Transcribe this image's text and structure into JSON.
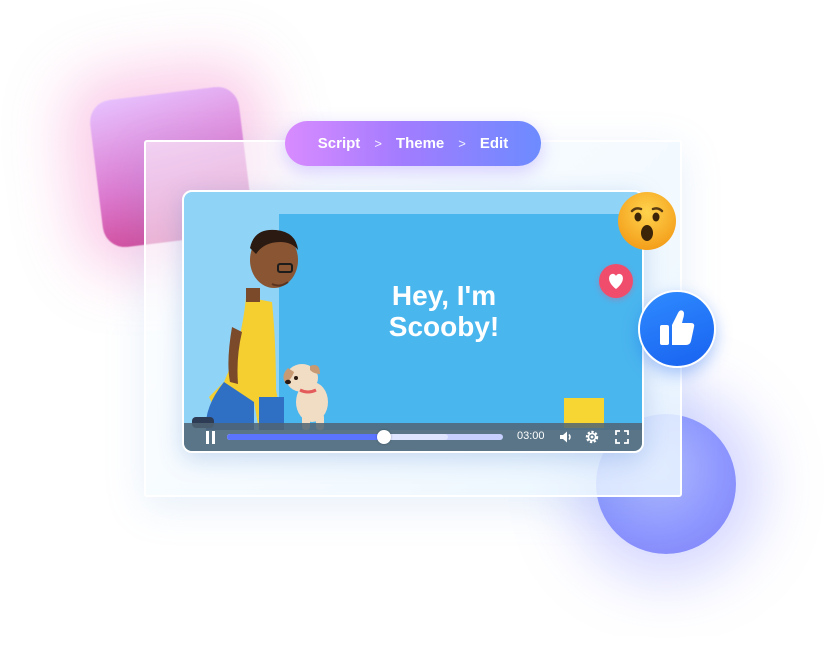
{
  "breadcrumb": {
    "steps": [
      "Script",
      "Theme",
      "Edit"
    ]
  },
  "video": {
    "title": "Hey, I'm\nScooby!",
    "duration": "03:00",
    "progress": 0.57,
    "buffered": 0.8
  },
  "reactions": [
    "wow-emoji",
    "heart-reaction",
    "thumbs-up-reaction"
  ],
  "icons": [
    "pause-icon",
    "volume-icon",
    "settings-gear-icon",
    "fullscreen-icon"
  ],
  "colors": {
    "accent": "#5b74ff",
    "breadcrumb_start": "#d98bff",
    "breadcrumb_end": "#6d8bff",
    "scene_background": "#4ab6ee",
    "heart": "#f04d6c",
    "like": "#1877f2"
  }
}
